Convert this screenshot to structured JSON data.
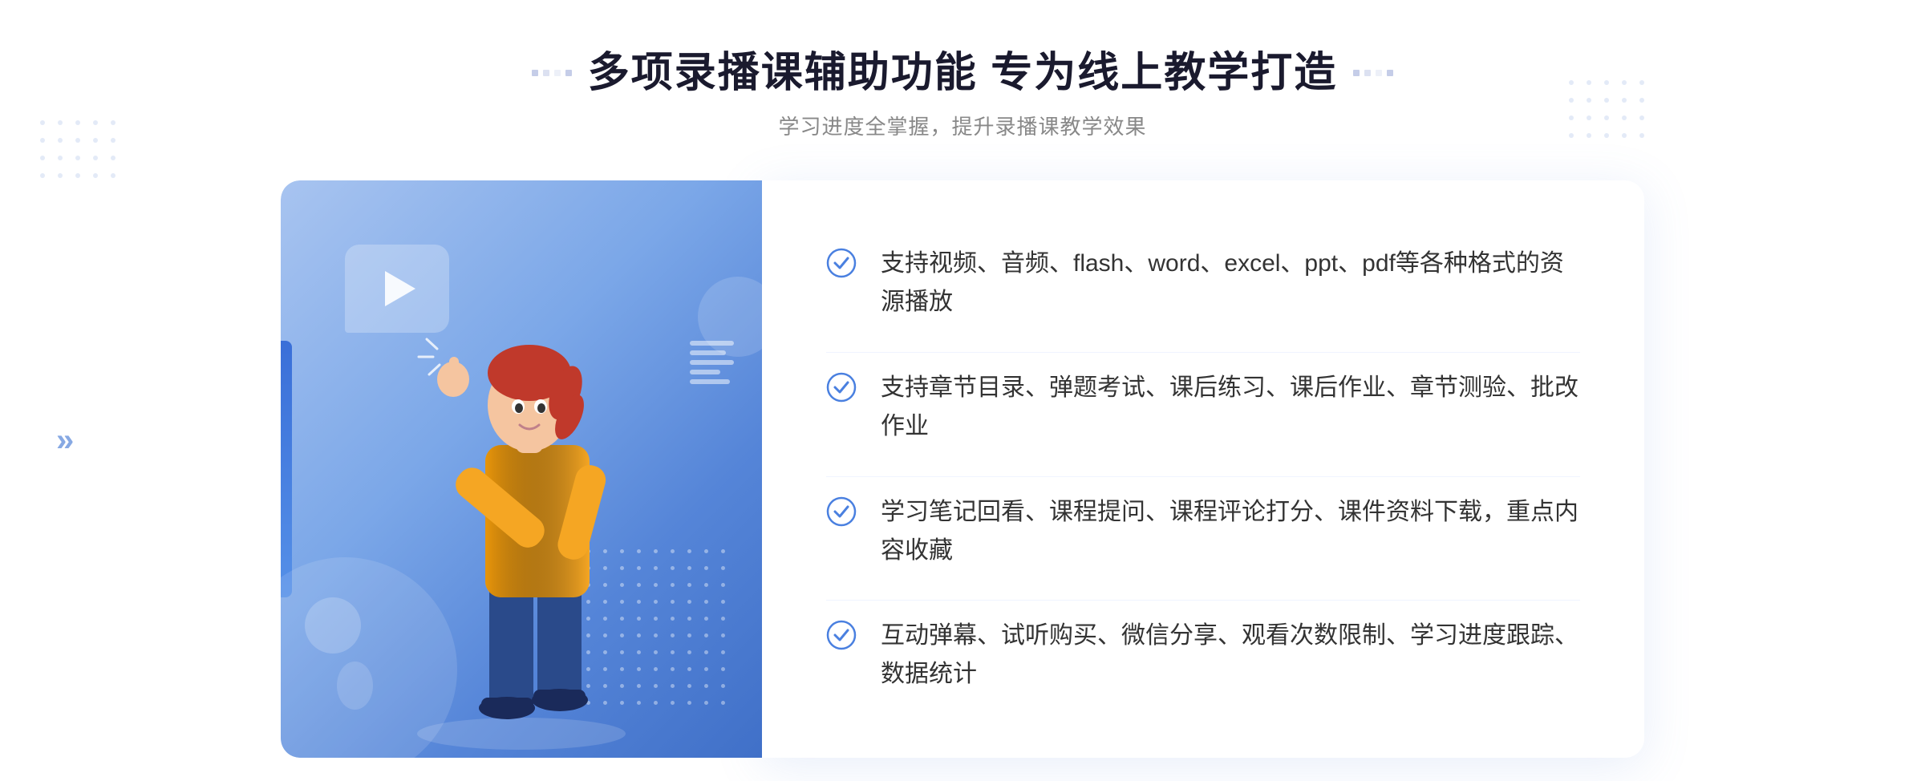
{
  "header": {
    "title": "多项录播课辅助功能 专为线上教学打造",
    "subtitle": "学习进度全掌握，提升录播课教学效果",
    "title_left_decorator": ":::",
    "title_right_decorator": ":::"
  },
  "features": [
    {
      "id": 1,
      "text": "支持视频、音频、flash、word、excel、ppt、pdf等各种格式的资源播放"
    },
    {
      "id": 2,
      "text": "支持章节目录、弹题考试、课后练习、课后作业、章节测验、批改作业"
    },
    {
      "id": 3,
      "text": "学习笔记回看、课程提问、课程评论打分、课件资料下载，重点内容收藏"
    },
    {
      "id": 4,
      "text": "互动弹幕、试听购买、微信分享、观看次数限制、学习进度跟踪、数据统计"
    }
  ],
  "colors": {
    "primary_blue": "#4a80e0",
    "light_blue": "#a8c4f0",
    "text_dark": "#1a1a2e",
    "text_gray": "#888888",
    "text_body": "#333333",
    "check_color": "#4a80e0",
    "accent": "#5585d8"
  },
  "icons": {
    "check": "check-circle",
    "play": "play-triangle",
    "left_arrow": "«",
    "right_arrow": "»"
  }
}
